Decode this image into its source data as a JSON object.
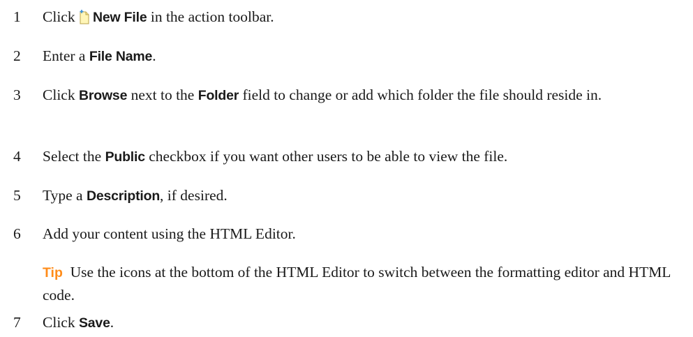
{
  "steps": [
    {
      "num": "1",
      "p1": "Click ",
      "icon": "new-file-icon",
      "b1": "New File",
      "p2": " in the action toolbar."
    },
    {
      "num": "2",
      "p1": "Enter a ",
      "b1": "File Name",
      "p2": "."
    },
    {
      "num": "3",
      "p1": "Click ",
      "b1": "Browse",
      "p2": " next to the ",
      "b2": "Folder",
      "p3": " field to change or add which folder the file should reside in."
    },
    {
      "num": "4",
      "p1": "Select the ",
      "b1": "Public",
      "p2": " checkbox if you want other users to be able to view the file."
    },
    {
      "num": "5",
      "p1": "Type a ",
      "b1": "Description",
      "p2": ", if desired."
    },
    {
      "num": "6",
      "p1": "Add your content using the HTML Editor."
    },
    {
      "num": "7",
      "p1": "Click ",
      "b1": "Save",
      "p2": "."
    }
  ],
  "tip": {
    "label": "Tip",
    "text": "Use the icons at the bottom of the HTML Editor to switch between the formatting editor and HTML code."
  },
  "colors": {
    "tip_label": "#ff8c1a",
    "icon_page": "#fff6b8",
    "icon_spark": "#3a8fd6"
  }
}
